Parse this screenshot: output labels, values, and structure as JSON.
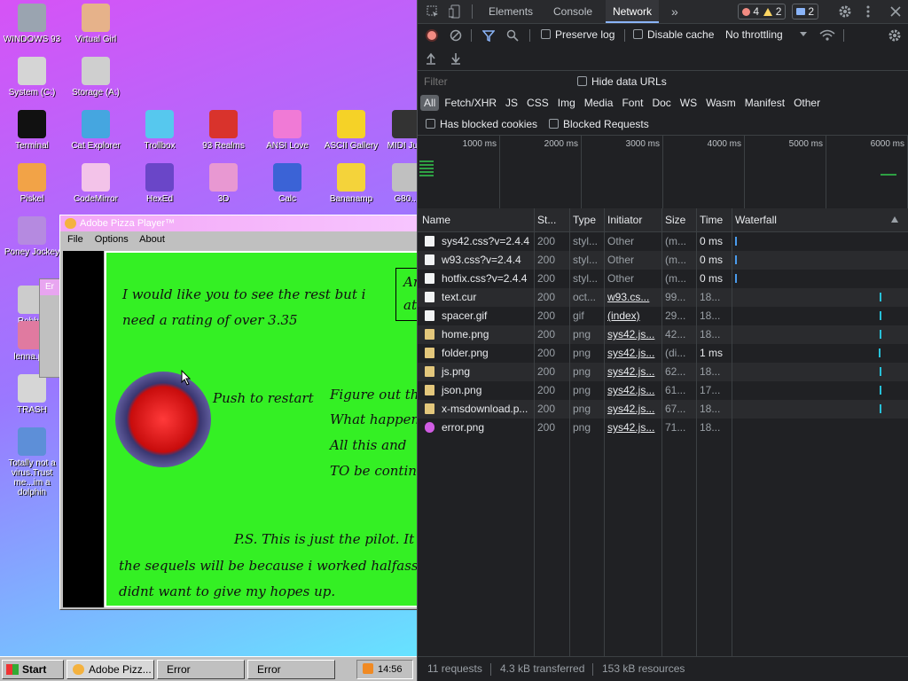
{
  "desktop": {
    "icons": [
      {
        "label": "WINDOWS 93",
        "icon": "computer-icon",
        "color": "#9aa4b0"
      },
      {
        "label": "Virtual Girl",
        "icon": "portrait-icon",
        "color": "#e6b28a"
      },
      {
        "label": "System (C:)",
        "icon": "drive-icon",
        "color": "#d5d5d5"
      },
      {
        "label": "Storage (A:)",
        "icon": "floppy-icon",
        "color": "#cfcfcf"
      },
      {
        "label": "Terminal",
        "icon": "terminal-icon",
        "color": "#111111"
      },
      {
        "label": "Cat Explorer",
        "icon": "globe-cat-icon",
        "color": "#45a6e0"
      },
      {
        "label": "Trollbox",
        "icon": "chat-icon",
        "color": "#56c8ee"
      },
      {
        "label": "93 Realms",
        "icon": "knight-icon",
        "color": "#d9332c"
      },
      {
        "label": "ANSI Love",
        "icon": "letter-a-icon",
        "color": "#f07ad6"
      },
      {
        "label": "ASCII Gallery",
        "icon": "numbers-icon",
        "color": "#f5d227"
      },
      {
        "label": "MIDI Ju...",
        "icon": "piano-icon",
        "color": "#333333"
      },
      {
        "label": "Piskel",
        "icon": "palette-icon",
        "color": "#f2a347"
      },
      {
        "label": "CodeMirror",
        "icon": "mirror-icon",
        "color": "#f3c3e9"
      },
      {
        "label": "HexEd",
        "icon": "hexagon-icon",
        "color": "#6a46c8"
      },
      {
        "label": "3D",
        "icon": "teapot-icon",
        "color": "#e898d2"
      },
      {
        "label": "Calc",
        "icon": "calculator-icon",
        "color": "#3b63d6"
      },
      {
        "label": "Bananamp",
        "icon": "banana-icon",
        "color": "#f4d33a"
      },
      {
        "label": "G80...",
        "icon": "app-icon",
        "color": "#c0c0c0"
      },
      {
        "label": "Poney Jockey",
        "icon": "pony-icon",
        "color": "#b58ae0"
      },
      {
        "label": "Robb...",
        "icon": "robot-icon",
        "color": "#cccccc"
      },
      {
        "label": "lenna.p...",
        "icon": "image-file-icon",
        "color": "#e07aa0"
      },
      {
        "label": "TRASH",
        "icon": "trash-icon",
        "color": "#d6d6d6"
      },
      {
        "label": "Totally not a virus.Trust me...im a dolphin",
        "icon": "dolphin-icon",
        "color": "#5d8fd8"
      }
    ],
    "pizza_window": {
      "title": "Adobe Pizza Player™",
      "menu": [
        "File",
        "Options",
        "About"
      ],
      "lines": [
        "I would like you to see the rest but i",
        "need a rating of over 3.35",
        "Push to restart",
        "Figure out the",
        "What happens",
        "All this and",
        "TO be contin",
        "P.S. This is just the pilot. It",
        "the sequels will be because i worked halfass o",
        "didnt want to give my hopes up.",
        "Ar",
        "at"
      ]
    },
    "error_window": {
      "title": "Er"
    },
    "taskbar": {
      "start": "Start",
      "items": [
        "Adobe Pizz...",
        "Error",
        "Error"
      ],
      "time": "14:56"
    }
  },
  "devtools": {
    "tabs": [
      "Elements",
      "Console",
      "Network"
    ],
    "active_tab": "Network",
    "more": "»",
    "badges": {
      "errors": "4",
      "warnings": "2",
      "messages": "2"
    },
    "toolbar": {
      "preserve_log": "Preserve log",
      "disable_cache": "Disable cache",
      "throttling": "No throttling"
    },
    "filter": {
      "placeholder": "Filter",
      "hide_data_urls": "Hide data URLs",
      "types": [
        "All",
        "Fetch/XHR",
        "JS",
        "CSS",
        "Img",
        "Media",
        "Font",
        "Doc",
        "WS",
        "Wasm",
        "Manifest",
        "Other"
      ],
      "has_blocked_cookies": "Has blocked cookies",
      "blocked_requests": "Blocked Requests"
    },
    "timeline_ticks": [
      "1000 ms",
      "2000 ms",
      "3000 ms",
      "4000 ms",
      "5000 ms",
      "6000 ms"
    ],
    "columns": {
      "name": "Name",
      "status": "St...",
      "type": "Type",
      "initiator": "Initiator",
      "size": "Size",
      "time": "Time",
      "waterfall": "Waterfall"
    },
    "requests": [
      {
        "name": "sys42.css?v=2.4.4",
        "status": "200",
        "type": "styl...",
        "initiator": "Other",
        "size": "(m...",
        "time": "0 ms",
        "icon": "stylesheet-icon"
      },
      {
        "name": "w93.css?v=2.4.4",
        "status": "200",
        "type": "styl...",
        "initiator": "Other",
        "size": "(m...",
        "time": "0 ms",
        "icon": "stylesheet-icon"
      },
      {
        "name": "hotfix.css?v=2.4.4",
        "status": "200",
        "type": "styl...",
        "initiator": "Other",
        "size": "(m...",
        "time": "0 ms",
        "icon": "stylesheet-icon"
      },
      {
        "name": "text.cur",
        "status": "200",
        "type": "oct...",
        "initiator": "w93.cs...",
        "size": "99...",
        "time": "18...",
        "icon": "file-icon"
      },
      {
        "name": "spacer.gif",
        "status": "200",
        "type": "gif",
        "initiator": "(index)",
        "size": "29...",
        "time": "18...",
        "icon": "file-icon"
      },
      {
        "name": "home.png",
        "status": "200",
        "type": "png",
        "initiator": "sys42.js...",
        "size": "42...",
        "time": "18...",
        "icon": "image-icon"
      },
      {
        "name": "folder.png",
        "status": "200",
        "type": "png",
        "initiator": "sys42.js...",
        "size": "(di...",
        "time": "1 ms",
        "icon": "image-icon"
      },
      {
        "name": "js.png",
        "status": "200",
        "type": "png",
        "initiator": "sys42.js...",
        "size": "62...",
        "time": "18...",
        "icon": "image-icon"
      },
      {
        "name": "json.png",
        "status": "200",
        "type": "png",
        "initiator": "sys42.js...",
        "size": "61...",
        "time": "17...",
        "icon": "image-icon"
      },
      {
        "name": "x-msdownload.p...",
        "status": "200",
        "type": "png",
        "initiator": "sys42.js...",
        "size": "67...",
        "time": "18...",
        "icon": "image-icon"
      },
      {
        "name": "error.png",
        "status": "200",
        "type": "png",
        "initiator": "sys42.js...",
        "size": "71...",
        "time": "18...",
        "icon": "error-image-icon"
      }
    ],
    "summary": {
      "requests": "11 requests",
      "transferred": "4.3 kB transferred",
      "resources": "153 kB resources"
    },
    "colors": {
      "accent": "#8ab4f8",
      "waterfall_early": "#4a9ced",
      "waterfall_late": "#28c0d8",
      "error": "#f28b82",
      "warning": "#fdd663"
    }
  }
}
